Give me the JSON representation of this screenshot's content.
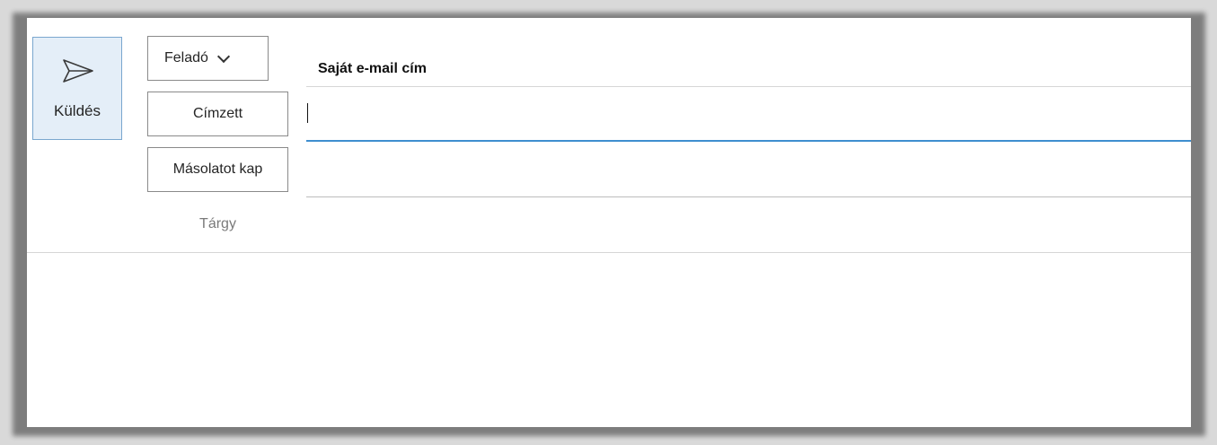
{
  "toolbar": {
    "send_label": "Küldés",
    "send_icon": "send-icon"
  },
  "header": {
    "from_button_label": "Feladó",
    "from_dropdown_icon": "chevron-down-icon",
    "from_value": "Saját e-mail cím",
    "to_button_label": "Címzett",
    "to_value": "",
    "cc_button_label": "Másolatot kap",
    "cc_value": "",
    "subject_label": "Tárgy",
    "subject_value": ""
  },
  "body": {
    "text": ""
  },
  "colors": {
    "accent": "#3e8ecf",
    "send_bg": "#e4eef8",
    "send_border": "#7aa7cf",
    "border": "#8a8a8a",
    "muted_text": "#7a7a7a"
  }
}
